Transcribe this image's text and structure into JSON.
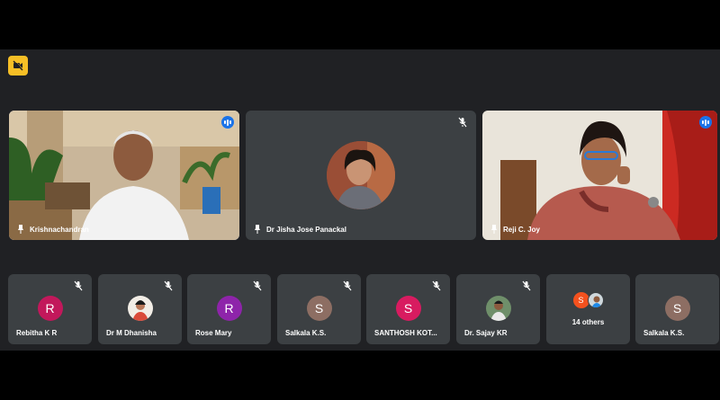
{
  "colors": {
    "stage_bg": "#202124",
    "tile_bg": "#3c4043",
    "active_outline": "#8ab4f8",
    "speaking_blue": "#1a73e8",
    "camera_off_yellow": "#f6bf26"
  },
  "toolbar": {
    "camera_off_icon": "video-off-icon"
  },
  "main_tiles": [
    {
      "name": "Krishnachandran",
      "pinned": true,
      "speaking": true,
      "active": true
    },
    {
      "name": "Dr Jisha Jose Panackal",
      "pinned": true,
      "muted": true
    },
    {
      "name": "Reji C. Joy",
      "pinned": true,
      "speaking": true
    }
  ],
  "participants": [
    {
      "name": "Rebitha K R",
      "initial": "R",
      "avatar_color": "#c2185b",
      "muted": true
    },
    {
      "name": "Dr M Dhanisha",
      "initial": "",
      "avatar_type": "photo",
      "muted": true
    },
    {
      "name": "Rose Mary",
      "initial": "R",
      "avatar_color": "#8e24aa",
      "muted": true
    },
    {
      "name": "Salkala K.S.",
      "initial": "S",
      "avatar_color": "#8d6e63",
      "muted": true
    },
    {
      "name": "SANTHOSH KOT...",
      "initial": "S",
      "avatar_color": "#d81b60",
      "muted": true
    },
    {
      "name": "Dr. Sajay KR",
      "initial": "",
      "avatar_type": "photo",
      "muted": true
    },
    {
      "name": "14 others",
      "initial": "S",
      "avatar_color": "#f4511e"
    },
    {
      "name": "Salkala K.S.",
      "initial": "S",
      "avatar_color": "#8d6e63"
    }
  ]
}
